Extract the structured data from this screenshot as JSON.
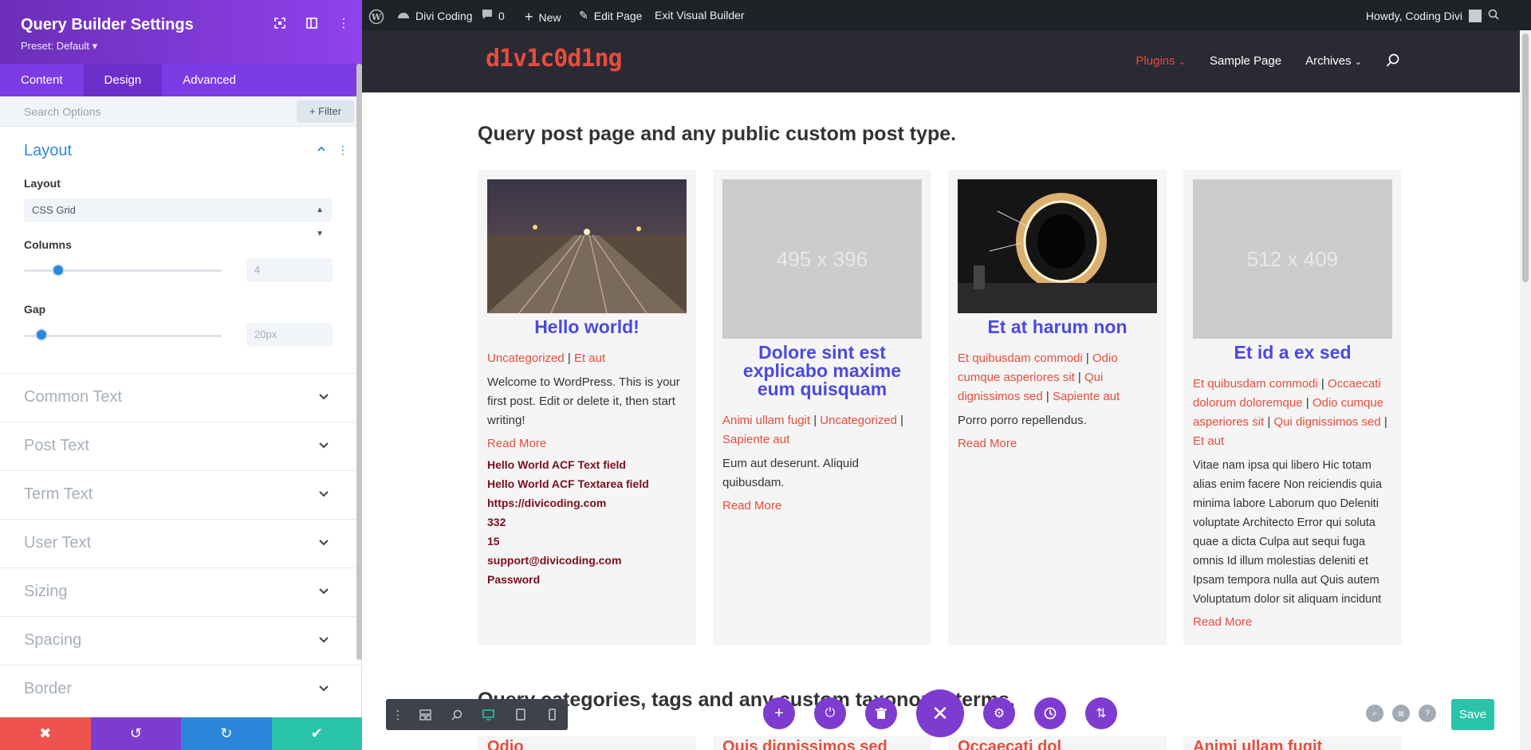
{
  "panel": {
    "title": "Query Builder Settings",
    "preset": "Preset: Default ▾",
    "tabs": [
      {
        "label": "Content",
        "active": false
      },
      {
        "label": "Design",
        "active": true
      },
      {
        "label": "Advanced",
        "active": false
      }
    ],
    "search_placeholder": "Search Options",
    "filter_label": "+ Filter",
    "layout_section": {
      "title": "Layout",
      "layout_label": "Layout",
      "layout_value": "CSS Grid",
      "columns_label": "Columns",
      "columns_value": "4",
      "gap_label": "Gap",
      "gap_value": "20px"
    },
    "accordion": [
      "Common Text",
      "Post Text",
      "Term Text",
      "User Text",
      "Sizing",
      "Spacing",
      "Border"
    ]
  },
  "adminbar": {
    "site": "Divi Coding",
    "comments": "0",
    "new": "New",
    "edit_page": "Edit Page",
    "exit": "Exit Visual Builder",
    "howdy": "Howdy, Coding Divi"
  },
  "site": {
    "logo": "d1v1c0d1ng",
    "nav": [
      {
        "label": "Plugins",
        "active": true,
        "has_dropdown": true
      },
      {
        "label": "Sample Page",
        "active": false,
        "has_dropdown": false
      },
      {
        "label": "Archives",
        "active": false,
        "has_dropdown": true
      }
    ]
  },
  "page": {
    "heading": "Query post page and any public custom post type.",
    "heading2": "Query categories, tags and any custom taxonomy terms.",
    "cards": [
      {
        "image": "photo-railway",
        "title": "Hello world!",
        "meta": [
          "Uncategorized",
          "Et aut"
        ],
        "body": "Welcome to WordPress. This is your first post. Edit or delete it, then start writing!",
        "read_more": "Read More",
        "acf": [
          "Hello World ACF Text field",
          "Hello World ACF Textarea field",
          "https://divicoding.com",
          "332",
          "15",
          "support@divicoding.com",
          "Password"
        ]
      },
      {
        "image_text": "495 x 396",
        "title": "Dolore sint est explicabo maxime eum quisquam",
        "meta": [
          "Animi ullam fugit",
          "Uncategorized",
          "Sapiente aut"
        ],
        "body": "Eum aut deserunt. Aliquid quibusdam.",
        "read_more": "Read More"
      },
      {
        "image": "photo-light-ring",
        "title": "Et at harum non",
        "meta": [
          "Et quibusdam commodi",
          "Odio cumque asperiores sit",
          "Qui dignissimos sed",
          "Sapiente aut"
        ],
        "body": "Porro porro repellendus.",
        "read_more": "Read More"
      },
      {
        "image_text": "512 x 409",
        "title": "Et id a ex sed",
        "meta": [
          "Et quibusdam commodi",
          "Occaecati dolorum doloremque",
          "Odio cumque asperiores sit",
          "Qui dignissimos sed",
          "Et aut"
        ],
        "body": "Vitae nam ipsa qui libero Hic totam alias enim facere Non reiciendis quia minima labore Laborum quo Deleniti voluptate Architecto Error qui soluta quae a dicta Culpa aut sequi fuga omnis Id illum molestias deleniti et Ipsam tempora nulla aut Quis autem Voluptatum dolor sit aliquam incidunt",
        "read_more": "Read More"
      }
    ],
    "next_cards": [
      "Odio",
      "Quis dignissimos sed",
      "Occaecati dol",
      "Animi ullam fugit"
    ]
  },
  "builder": {
    "save_label": "Save"
  },
  "colors": {
    "purple": "#7e3bd0",
    "accent_red": "#e74c3c",
    "title_blue": "#4a4ae0",
    "teal": "#29c4a9",
    "wp_blue": "#2b87da"
  }
}
